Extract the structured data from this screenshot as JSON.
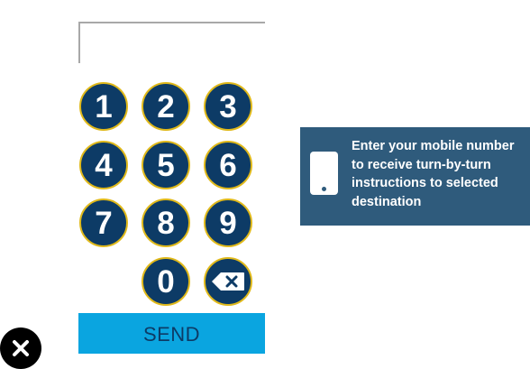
{
  "phone_field": {
    "value": ""
  },
  "keypad": {
    "keys": [
      "1",
      "2",
      "3",
      "4",
      "5",
      "6",
      "7",
      "8",
      "9",
      "0"
    ],
    "backspace_icon": "backspace-icon"
  },
  "send_label": "SEND",
  "info": {
    "icon": "mobile-phone-icon",
    "text": "Enter your mobile number to receive turn-by-turn instructions to selected destination"
  },
  "close_icon": "close-icon",
  "colors": {
    "key_fill": "#0d3b66",
    "key_ring": "#e0b91a",
    "send_bg": "#0aa5e0",
    "send_text": "#0d3b66",
    "panel_bg": "#2f5b7c"
  }
}
